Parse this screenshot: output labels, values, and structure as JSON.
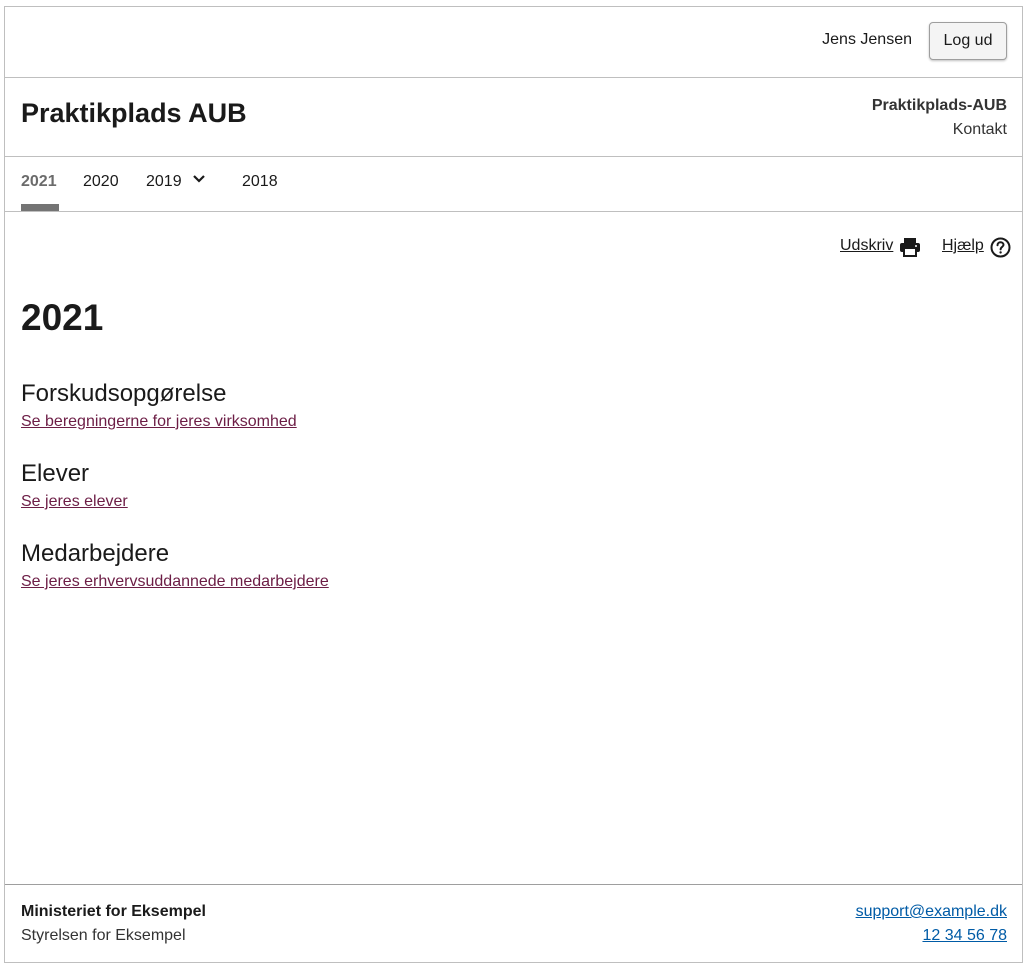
{
  "user": {
    "name": "Jens Jensen",
    "logout_label": "Log ud"
  },
  "header": {
    "title": "Praktikplads AUB",
    "org_name": "Praktikplads-AUB",
    "contact_label": "Kontakt"
  },
  "tabs": [
    {
      "label": "2021",
      "active": true
    },
    {
      "label": "2020",
      "active": false
    },
    {
      "label": "2019",
      "active": false,
      "has_dropdown": true
    },
    {
      "label": "2018",
      "active": false
    }
  ],
  "utilities": {
    "print_label": "Udskriv",
    "print_icon": "printer-icon",
    "help_label": "Hjælp",
    "help_icon": "help-circle-icon"
  },
  "main": {
    "year_heading": "2021",
    "sections": [
      {
        "title": "Forskudsopgørelse",
        "link": "Se beregningerne for jeres virksomhed"
      },
      {
        "title": "Elever",
        "link": "Se jeres elever"
      },
      {
        "title": "Medarbejdere",
        "link": "Se jeres erhvervsuddannede medarbejdere"
      }
    ]
  },
  "footer": {
    "ministry": "Ministeriet for Eksempel",
    "agency": "Styrelsen for Eksempel",
    "email": "support@example.dk",
    "phone": "12 34 56 78"
  },
  "colors": {
    "link_visited": "#6c1d45",
    "footer_link": "#005ba6",
    "tab_indicator": "#747474",
    "border": "#bfbfbf"
  }
}
